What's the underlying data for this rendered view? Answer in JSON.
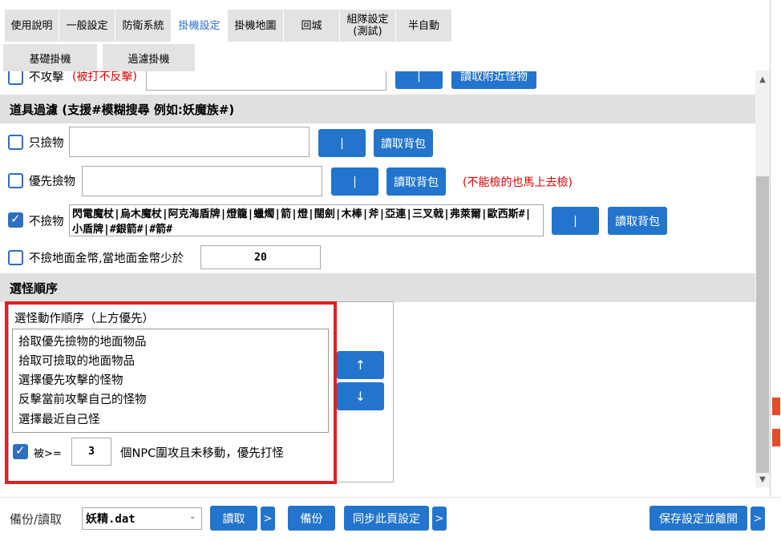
{
  "tabs": [
    {
      "label": "使用說明"
    },
    {
      "label": "一般設定"
    },
    {
      "label": "防衛系統"
    },
    {
      "label": "掛機設定"
    },
    {
      "label": "掛機地圖"
    },
    {
      "label": "回城"
    },
    {
      "label": "組隊設定\n(測試)"
    },
    {
      "label": "半自動"
    }
  ],
  "active_tab": "掛機設定",
  "subtabs": [
    {
      "label": "基礎掛機"
    },
    {
      "label": "過濾掛機"
    }
  ],
  "partial_row": {
    "checkbox_label": "不攻擊",
    "note": "(被打不反擊)",
    "pipe_button": "|",
    "read_button": "讀取附近怪物"
  },
  "item_filter": {
    "title": "道具過濾 (支援#模糊搜尋 例如:妖魔族#)",
    "rows": [
      {
        "label": "只撿物",
        "checked": false,
        "value": "",
        "pipe_button": "|",
        "read_button": "讀取背包"
      },
      {
        "label": "優先撿物",
        "checked": false,
        "value": "",
        "pipe_button": "|",
        "read_button": "讀取背包",
        "note": "(不能檢的也馬上去檢)"
      },
      {
        "label": "不撿物",
        "checked": true,
        "value": "閃電魔杖|烏木魔杖|阿克海盾牌|燈籠|蠟燭|箭|燈|闊劍|木棒|斧|亞連|三叉戟|弗萊爾|歐西斯#|小盾牌|#銀箭#|#箭#",
        "pipe_button": "|",
        "read_button": "讀取背包"
      }
    ],
    "gold_row": {
      "label": "不撿地面金幣,當地面金幣少於",
      "checked": false,
      "value": "20"
    }
  },
  "monster_order": {
    "title": "選怪順序",
    "group_title": "選怪動作順序（上方優先）",
    "items": [
      "拾取優先撿物的地面物品",
      "拾取可撿取的地面物品",
      "選擇優先攻擊的怪物",
      "反擊當前攻擊自己的怪物",
      "選擇最近自己怪"
    ],
    "up_button": "↑",
    "down_button": "↓",
    "npc_row": {
      "prefix": "被>=",
      "value": "3",
      "suffix": "個NPC圍攻且未移動，優先打怪",
      "checked": true
    }
  },
  "footer": {
    "label": "備份/讀取",
    "file_value": "妖精.dat",
    "read_button": "讀取",
    "more": ">",
    "backup_button": "備份",
    "sync_button": "同步此頁設定",
    "save_button": "保存設定並離開"
  },
  "colors": {
    "accent": "#2374cc",
    "highlight": "#e02020",
    "note": "#e00000"
  }
}
